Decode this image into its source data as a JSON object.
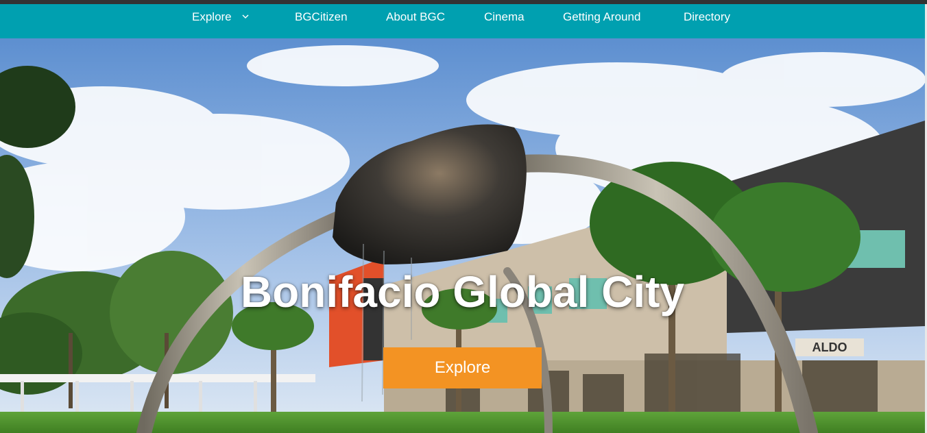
{
  "nav": {
    "items": [
      {
        "label": "Explore"
      },
      {
        "label": "BGCitizen"
      },
      {
        "label": "About BGC"
      },
      {
        "label": "Cinema"
      },
      {
        "label": "Getting Around"
      },
      {
        "label": "Directory"
      }
    ]
  },
  "hero": {
    "title": "Bonifacio Global City",
    "button_label": "Explore",
    "storefront_sign": "ALDO"
  },
  "colors": {
    "nav_background": "#00a0b0",
    "button_background": "#f39323",
    "top_line": "#333333"
  },
  "icons": {
    "explore_dropdown": "chevron-down-icon"
  }
}
